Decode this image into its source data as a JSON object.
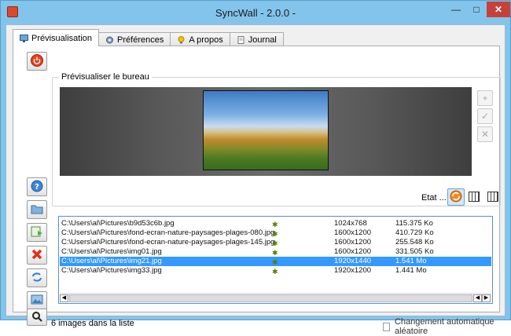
{
  "window": {
    "title": "SyncWall - 2.0.0 -",
    "controls": {
      "minimize": "—",
      "maximize": "□",
      "close": "✕"
    }
  },
  "tabs": [
    {
      "label": "Prévisualisation",
      "icon": "monitor-icon",
      "active": true
    },
    {
      "label": "Préférences",
      "icon": "gear-icon",
      "active": false
    },
    {
      "label": "A propos",
      "icon": "lightbulb-icon",
      "active": false
    },
    {
      "label": "Journal",
      "icon": "journal-icon",
      "active": false
    }
  ],
  "preview": {
    "group_label": "Prévisualiser le bureau"
  },
  "status": {
    "etat_label": "Etat ...",
    "count_text": "6 images dans la liste",
    "auto_change_label": "Changement automatique aléatoire",
    "auto_change_checked": false
  },
  "images": [
    {
      "path": "C:\\Users\\al\\Pictures\\b9d53c6b.jpg",
      "resolution": "1024x768",
      "size": "115.375 Ko",
      "selected": false
    },
    {
      "path": "C:\\Users\\al\\Pictures\\fond-ecran-nature-paysages-plages-080.jpg",
      "resolution": "1600x1200",
      "size": "410.729 Ko",
      "selected": false
    },
    {
      "path": "C:\\Users\\al\\Pictures\\fond-ecran-nature-paysages-plages-145.jpg",
      "resolution": "1600x1200",
      "size": "255.548 Ko",
      "selected": false
    },
    {
      "path": "C:\\Users\\al\\Pictures\\img01.jpg",
      "resolution": "1600x1200",
      "size": "331.505 Ko",
      "selected": false
    },
    {
      "path": "C:\\Users\\al\\Pictures\\img21.jpg",
      "resolution": "1920x1440",
      "size": "1.541 Mo",
      "selected": true
    },
    {
      "path": "C:\\Users\\al\\Pictures\\img33.jpg",
      "resolution": "1920x1200",
      "size": "1.441 Mo",
      "selected": false
    }
  ],
  "colors": {
    "accent": "#3399ff",
    "title_bar": "#83c4ec",
    "close": "#c7413b",
    "stop": "#e8401c",
    "delete": "#e0301c"
  }
}
